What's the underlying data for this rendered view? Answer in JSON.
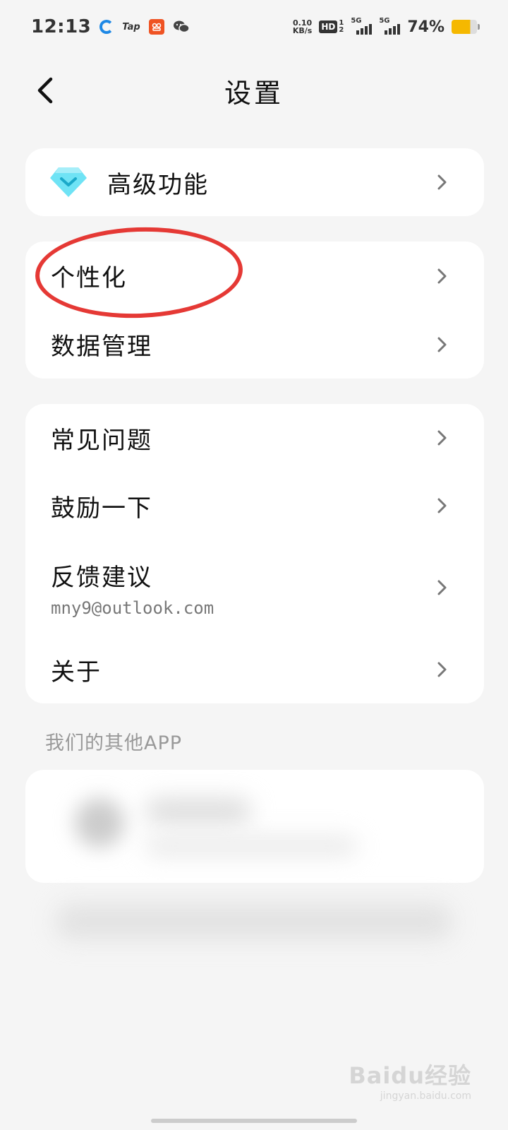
{
  "status_bar": {
    "time": "12:13",
    "tap_label": "Tap",
    "net_speed_value": "0.10",
    "net_speed_unit": "KB/s",
    "hd_label": "HD",
    "hd_sub_top": "1",
    "hd_sub_bottom": "2",
    "signal1_label": "5G",
    "signal2_label": "5G",
    "battery_percent": "74%",
    "battery_level": 0.74,
    "battery_color": "#f5b800"
  },
  "header": {
    "title": "设置"
  },
  "card_premium": {
    "label": "高级功能",
    "icon": "diamond-icon",
    "icon_color": "#4dd8f0"
  },
  "card_general": {
    "items": [
      {
        "label": "个性化"
      },
      {
        "label": "数据管理"
      }
    ]
  },
  "card_support": {
    "items": [
      {
        "label": "常见问题"
      },
      {
        "label": "鼓励一下"
      },
      {
        "label": "反馈建议",
        "sub": "mny9@outlook.com"
      },
      {
        "label": "关于"
      }
    ]
  },
  "other_apps": {
    "section_label": "我们的其他APP"
  },
  "watermark": {
    "logo": "Baidu经验",
    "sub": "jingyan.baidu.com"
  },
  "colors": {
    "annotation": "#e53935",
    "background": "#f5f5f5",
    "card": "#ffffff"
  }
}
